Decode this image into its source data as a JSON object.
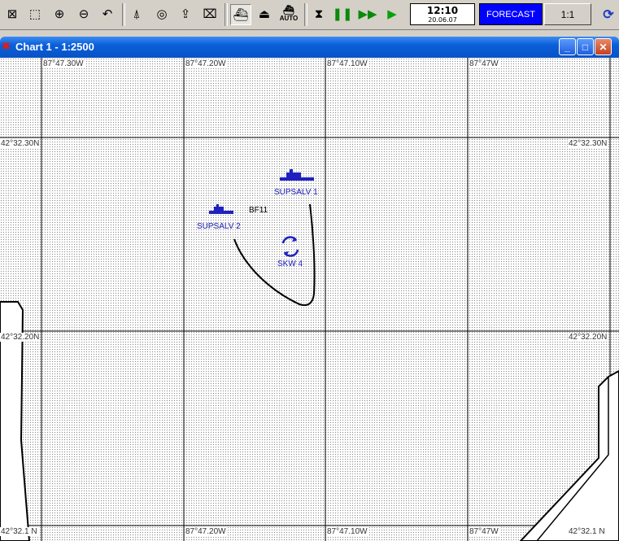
{
  "toolbar": {
    "clock": {
      "time": "12:10",
      "date": "20.06.07"
    },
    "forecast_label": "FORECAST",
    "scale_label": "1:1",
    "auto_label": "AUTO"
  },
  "window": {
    "title": "Chart 1 - 1:2500",
    "buttons": {
      "minimize": "_",
      "maximize": "□",
      "close": "✕"
    }
  },
  "chart": {
    "top_lon_labels": [
      "87°47.30W",
      "87°47.20W",
      "87°47.10W",
      "87°47W"
    ],
    "bottom_lon_labels": [
      "87°47.20W",
      "87°47.10W",
      "87°47W"
    ],
    "lat_labels_left": [
      "42°32.30N",
      "42°32.20N",
      "42°32.1 N"
    ],
    "lat_labels_right": [
      "42°32.30N",
      "42°32.20N",
      "42°32.1 N"
    ],
    "targets": {
      "vessel_1": "SUPSALV 1",
      "vessel_2": "SUPSALV 2",
      "buoy": "BF11",
      "skw": "SKW 4"
    }
  }
}
